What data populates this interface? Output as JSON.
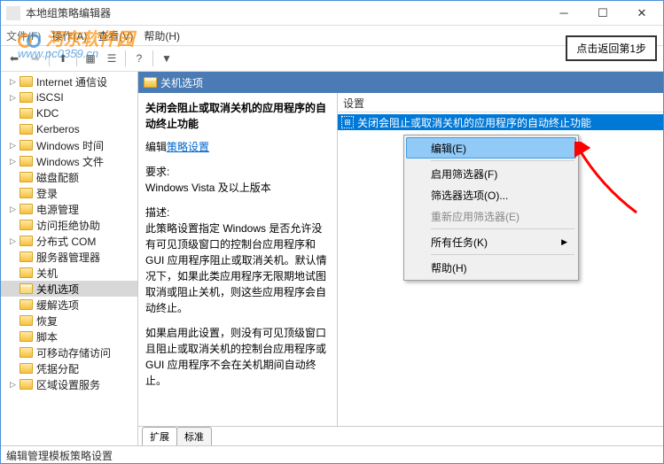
{
  "window": {
    "title": "本地组策略编辑器"
  },
  "menubar": {
    "file": "文件(F)",
    "action": "操作(A)",
    "view": "查看(V)",
    "help": "帮助(H)"
  },
  "callout": {
    "returnStep1": "点击返回第1步"
  },
  "tree": {
    "items": [
      {
        "label": "Internet 通信设",
        "exp": true
      },
      {
        "label": "iSCSI",
        "exp": true
      },
      {
        "label": "KDC",
        "exp": false
      },
      {
        "label": "Kerberos",
        "exp": false
      },
      {
        "label": "Windows 时间",
        "exp": true
      },
      {
        "label": "Windows 文件",
        "exp": true
      },
      {
        "label": "磁盘配额",
        "exp": false
      },
      {
        "label": "登录",
        "exp": false
      },
      {
        "label": "电源管理",
        "exp": true
      },
      {
        "label": "访问拒绝协助",
        "exp": false
      },
      {
        "label": "分布式 COM",
        "exp": true
      },
      {
        "label": "服务器管理器",
        "exp": false
      },
      {
        "label": "关机",
        "exp": false
      },
      {
        "label": "关机选项",
        "exp": false,
        "selected": true
      },
      {
        "label": "缓解选项",
        "exp": false
      },
      {
        "label": "恢复",
        "exp": false
      },
      {
        "label": "脚本",
        "exp": false
      },
      {
        "label": "可移动存储访问",
        "exp": false
      },
      {
        "label": "凭据分配",
        "exp": false
      },
      {
        "label": "区域设置服务",
        "exp": true
      }
    ]
  },
  "content": {
    "headerTitle": "关机选项",
    "desc": {
      "item_title": "关闭会阻止或取消关机的应用程序的自动终止功能",
      "edit_link_pre": "编辑",
      "edit_link": "策略设置",
      "req_label": "要求:",
      "req_value": "Windows Vista 及以上版本",
      "desc_label": "描述:",
      "desc_text1": "此策略设置指定 Windows 是否允许没有可见顶级窗口的控制台应用程序和 GUI 应用程序阻止或取消关机。默认情况下，如果此类应用程序无限期地试图取消或阻止关机，则这些应用程序会自动终止。",
      "desc_text2": "如果启用此设置，则没有可见顶级窗口且阻止或取消关机的控制台应用程序或 GUI 应用程序不会在关机期间自动终止。"
    },
    "settings": {
      "header": "设置",
      "row1": "关闭会阻止或取消关机的应用程序的自动终止功能"
    },
    "tabs": {
      "extended": "扩展",
      "standard": "标准"
    }
  },
  "context_menu": {
    "edit": "编辑(E)",
    "enable_filter": "启用筛选器(F)",
    "filter_options": "筛选器选项(O)...",
    "reapply_filter": "重新应用筛选器(E)",
    "all_tasks": "所有任务(K)",
    "help": "帮助(H)"
  },
  "statusbar": {
    "text": "编辑管理模板策略设置"
  },
  "watermark": {
    "line1": "河东软件园",
    "line2": "www.pc0359.cn"
  }
}
